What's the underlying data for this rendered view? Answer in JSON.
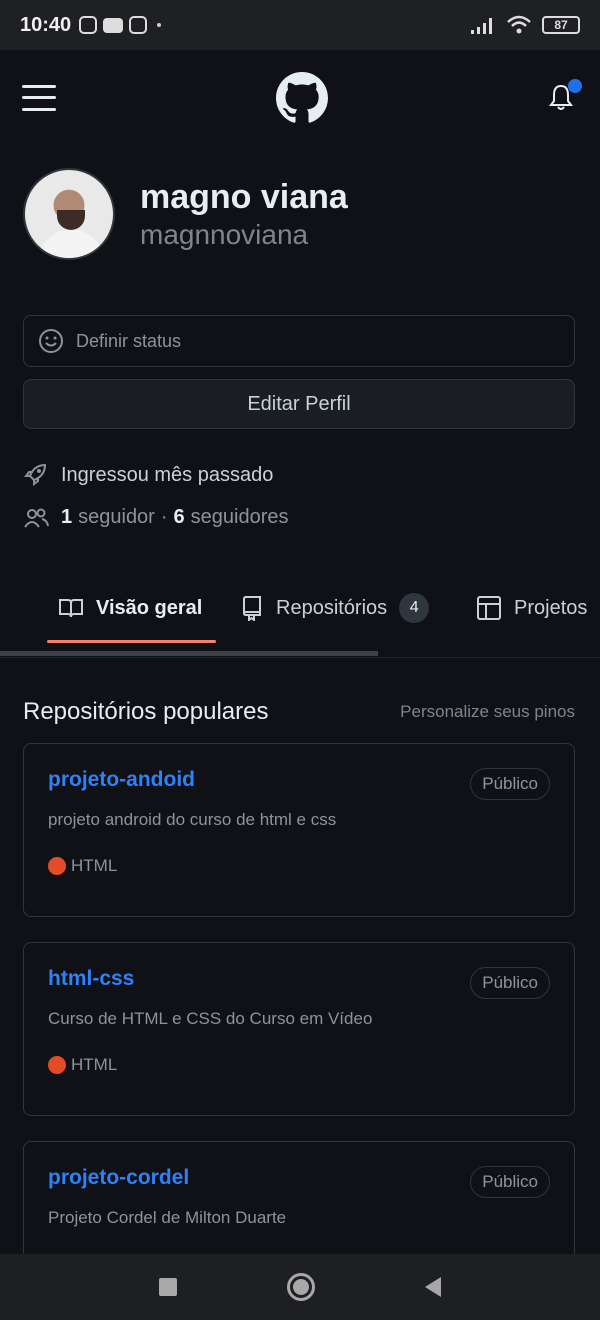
{
  "status_bar": {
    "time": "10:40",
    "battery": "87"
  },
  "header": {
    "menu_icon": "hamburger-icon",
    "logo_icon": "github-logo-icon",
    "notification_icon": "bell-icon",
    "accent_dot_color": "#1f6feb"
  },
  "profile": {
    "full_name": "magno viana",
    "login": "magnnoviana"
  },
  "status": {
    "placeholder": "Definir status"
  },
  "edit_profile_label": "Editar Perfil",
  "meta": {
    "joined": "Ingressou mês passado",
    "followers_count": "1",
    "followers_label": "seguidor",
    "separator": "·",
    "following_count": "6",
    "following_label": "seguidores"
  },
  "tabs": [
    {
      "label": "Visão geral",
      "icon": "book-icon",
      "active": true
    },
    {
      "label": "Repositórios",
      "icon": "repo-icon",
      "count": "4"
    },
    {
      "label": "Projetos",
      "icon": "table-icon"
    }
  ],
  "popular": {
    "title": "Repositórios populares",
    "customize_link": "Personalize seus pinos"
  },
  "repos": [
    {
      "name": "projeto-andoid",
      "visibility": "Público",
      "description": "projeto android do curso de html e css",
      "language": "HTML",
      "language_color": "#e34c26"
    },
    {
      "name": "html-css",
      "visibility": "Público",
      "description": "Curso de HTML e CSS do Curso em Vídeo",
      "language": "HTML",
      "language_color": "#e34c26"
    },
    {
      "name": "projeto-cordel",
      "visibility": "Público",
      "description": "Projeto Cordel de Milton Duarte",
      "language": "",
      "language_color": ""
    }
  ],
  "colors": {
    "link": "#2f81f7",
    "tab_underline": "#f78166",
    "background": "#0f1116"
  }
}
